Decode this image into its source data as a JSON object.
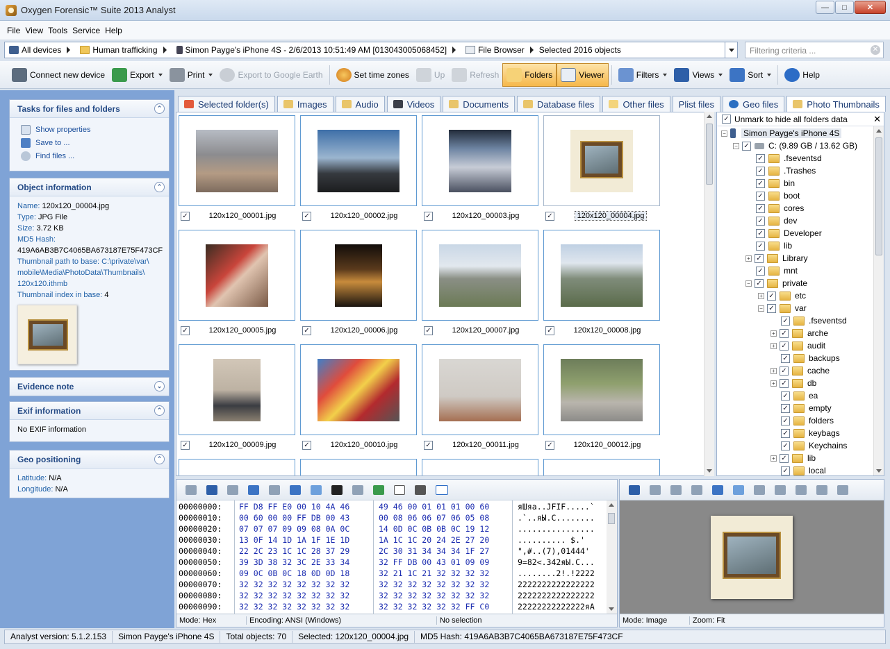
{
  "window": {
    "title": "Oxygen Forensic™ Suite 2013 Analyst"
  },
  "menu": [
    "File",
    "View",
    "Tools",
    "Service",
    "Help"
  ],
  "breadcrumb": [
    "All devices",
    "Human trafficking",
    "Simon Payge's iPhone 4S - 2/6/2013 10:51:49 AM [013043005068452]",
    "File Browser",
    "Selected 2016 objects"
  ],
  "filter": {
    "placeholder": "Filtering criteria ..."
  },
  "toolbar": {
    "connect": "Connect new device",
    "export": "Export",
    "print": "Print",
    "export_google": "Export to Google Earth",
    "time_zones": "Set time zones",
    "up": "Up",
    "refresh": "Refresh",
    "folders": "Folders",
    "viewer": "Viewer",
    "filters": "Filters",
    "views": "Views",
    "sort": "Sort",
    "help": "Help"
  },
  "tasks": {
    "title": "Tasks for files and folders",
    "items": [
      "Show properties",
      "Save to ...",
      "Find files ..."
    ]
  },
  "object_info": {
    "title": "Object information",
    "name_key": "Name:",
    "name": "120x120_00004.jpg",
    "type_key": "Type:",
    "type": "JPG File",
    "size_key": "Size:",
    "size": "3.72 KB",
    "md5_key": "MD5 Hash:",
    "md5": "419A6AB3B7C4065BA673187E75F473CF",
    "path_key": "Thumbnail path to base:",
    "path_1": "C:\\private\\var\\",
    "path_2": "mobile\\Media\\PhotoData\\Thumbnails\\",
    "path_3": "120x120.ithmb",
    "index_key": "Thumbnail index in base:",
    "index": "4"
  },
  "evidence": {
    "title": "Evidence note"
  },
  "exif": {
    "title": "Exif information",
    "text": "No EXIF information"
  },
  "geo": {
    "title": "Geo positioning",
    "lat_key": "Latitude:",
    "lat": "N/A",
    "lon_key": "Longitude:",
    "lon": "N/A"
  },
  "tabs": [
    "Selected folder(s)",
    "Images",
    "Audio",
    "Videos",
    "Documents",
    "Database files",
    "Other files",
    "Plist files",
    "Geo files",
    "Photo Thumbnails"
  ],
  "thumbs": [
    "120x120_00001.jpg",
    "120x120_00002.jpg",
    "120x120_00003.jpg",
    "120x120_00004.jpg",
    "120x120_00005.jpg",
    "120x120_00006.jpg",
    "120x120_00007.jpg",
    "120x120_00008.jpg",
    "120x120_00009.jpg",
    "120x120_00010.jpg",
    "120x120_00011.jpg",
    "120x120_00012.jpg"
  ],
  "tree": {
    "header": "Unmark to hide all folders data",
    "device": "Simon Payge's iPhone 4S",
    "drive": "C: (9.89 GB / 13.62 GB)",
    "level1": [
      ".fseventsd",
      ".Trashes",
      "bin",
      "boot",
      "cores",
      "dev",
      "Developer",
      "lib",
      "Library",
      "mnt",
      "private"
    ],
    "level2": [
      "etc",
      "var"
    ],
    "level3": [
      ".fseventsd",
      "arche",
      "audit",
      "backups",
      "cache",
      "db",
      "ea",
      "empty",
      "folders",
      "keybags",
      "Keychains",
      "lib",
      "local"
    ]
  },
  "hex": {
    "rows": [
      {
        "off": "00000000:",
        "b1": "FF D8 FF E0 00 10 4A 46",
        "b2": "49 46 00 01 01 01 00 60",
        "asc": "яШяа..JFIF.....`"
      },
      {
        "off": "00000010:",
        "b1": "00 60 00 00 FF DB 00 43",
        "b2": "00 08 06 06 07 06 05 08",
        "asc": ".`..яЫ.C........"
      },
      {
        "off": "00000020:",
        "b1": "07 07 07 09 09 08 0A 0C",
        "b2": "14 0D 0C 0B 0B 0C 19 12",
        "asc": "................"
      },
      {
        "off": "00000030:",
        "b1": "13 0F 14 1D 1A 1F 1E 1D",
        "b2": "1A 1C 1C 20 24 2E 27 20",
        "asc": ".......... $.' "
      },
      {
        "off": "00000040:",
        "b1": "22 2C 23 1C 1C 28 37 29",
        "b2": "2C 30 31 34 34 34 1F 27",
        "asc": "\",#..(7),01444'"
      },
      {
        "off": "00000050:",
        "b1": "39 3D 38 32 3C 2E 33 34",
        "b2": "32 FF DB 00 43 01 09 09",
        "asc": "9=82<.342яЫ.C..."
      },
      {
        "off": "00000060:",
        "b1": "09 0C 0B 0C 18 0D 0D 18",
        "b2": "32 21 1C 21 32 32 32 32",
        "asc": "........2!.!2222"
      },
      {
        "off": "00000070:",
        "b1": "32 32 32 32 32 32 32 32",
        "b2": "32 32 32 32 32 32 32 32",
        "asc": "2222222222222222"
      },
      {
        "off": "00000080:",
        "b1": "32 32 32 32 32 32 32 32",
        "b2": "32 32 32 32 32 32 32 32",
        "asc": "2222222222222222"
      },
      {
        "off": "00000090:",
        "b1": "32 32 32 32 32 32 32 32",
        "b2": "32 32 32 32 32 32 FF C0",
        "asc": "22222222222222яА"
      }
    ],
    "mode": "Mode: Hex",
    "encoding": "Encoding: ANSI (Windows)",
    "selection": "No selection"
  },
  "preview": {
    "mode": "Mode: Image",
    "zoom": "Zoom: Fit"
  },
  "status": {
    "version": "Analyst version: 5.1.2.153",
    "device": "Simon Payge's iPhone 4S",
    "total": "Total objects: 70",
    "selected": "Selected: 120x120_00004.jpg",
    "md5": "MD5 Hash: 419A6AB3B7C4065BA673187E75F473CF"
  }
}
